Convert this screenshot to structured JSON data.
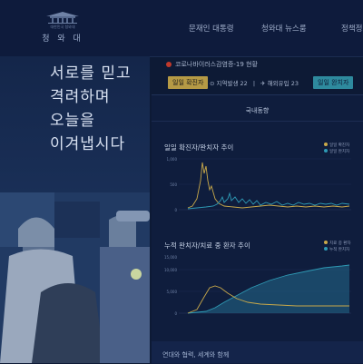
{
  "site": {
    "logo_name": "청 와 대",
    "logo_sub": "대한민국 청와대"
  },
  "nav": [
    "문재인 대통령",
    "청와대 뉴스룸",
    "정책정보"
  ],
  "hero": {
    "lines": [
      "서로를 믿고",
      "격려하며",
      "오늘을",
      "이겨냅시다"
    ]
  },
  "covid": {
    "notice": "코로나바이러스감염증-19 현황",
    "daily_label": "일일 확진자",
    "local_label": "지역발생",
    "local_value": "22",
    "overseas_label": "해외유입",
    "overseas_value": "23",
    "released_label": "일일 완치자"
  },
  "panel": {
    "title": "국내동향"
  },
  "charts": [
    {
      "title": "일일 확진자/완치자 추이",
      "legend": [
        "일일 확진자",
        "일일 완치자"
      ],
      "colors": [
        "#c9a94a",
        "#2e9ab5"
      ],
      "y_ticks": [
        "1,000",
        "500",
        "0"
      ]
    },
    {
      "title": "누적 완치자/치료 중 환자 추이",
      "legend": [
        "치료 중 환자",
        "누적 완치자"
      ],
      "colors": [
        "#c9a94a",
        "#2e9ab5"
      ],
      "y_ticks": [
        "15,000",
        "10,000",
        "5,000",
        "0"
      ]
    }
  ],
  "footer": {
    "text": "연대와 협력, 세계와 함께"
  }
}
